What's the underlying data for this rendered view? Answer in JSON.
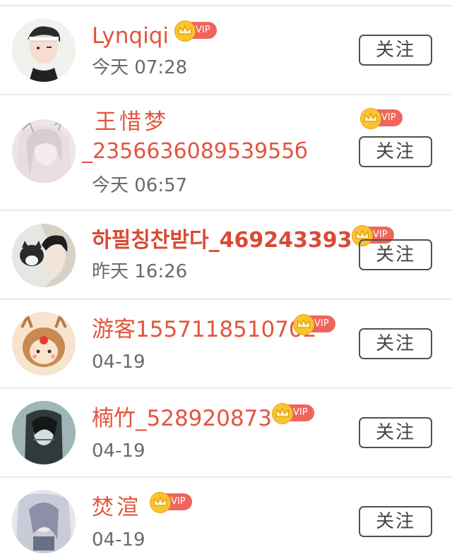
{
  "users": [
    {
      "name": "Lynqiqi",
      "time": "今天 07:28",
      "vip": true,
      "vip_label": "VIP",
      "follow_label": "关注"
    },
    {
      "name_line1": "王惜梦",
      "name_line2": "_235663608953955б",
      "time": "今天 06:57",
      "vip": true,
      "vip_label": "VIP",
      "follow_label": "关注"
    },
    {
      "name": "하필칭찬받다_469243393",
      "time": "昨天 16:26",
      "vip": true,
      "vip_label": "VIP",
      "follow_label": "关注"
    },
    {
      "name": "游客15571185107​02",
      "time": "04-19",
      "vip": true,
      "vip_label": "VIP",
      "follow_label": "关注"
    },
    {
      "name": "楠竹_528920873",
      "time": "04-19",
      "vip": true,
      "vip_label": "VIP",
      "follow_label": "关注"
    },
    {
      "name": "焚渲",
      "time": "04-19",
      "vip": true,
      "vip_label": "VIP",
      "follow_label": "关注"
    }
  ],
  "colors": {
    "name": "#e2553d",
    "vip_badge": "#f0655b",
    "vip_crown": "#f8c531",
    "divider": "#ececec",
    "button_border": "#505050"
  },
  "icons": [
    "crown-icon",
    "avatar"
  ]
}
